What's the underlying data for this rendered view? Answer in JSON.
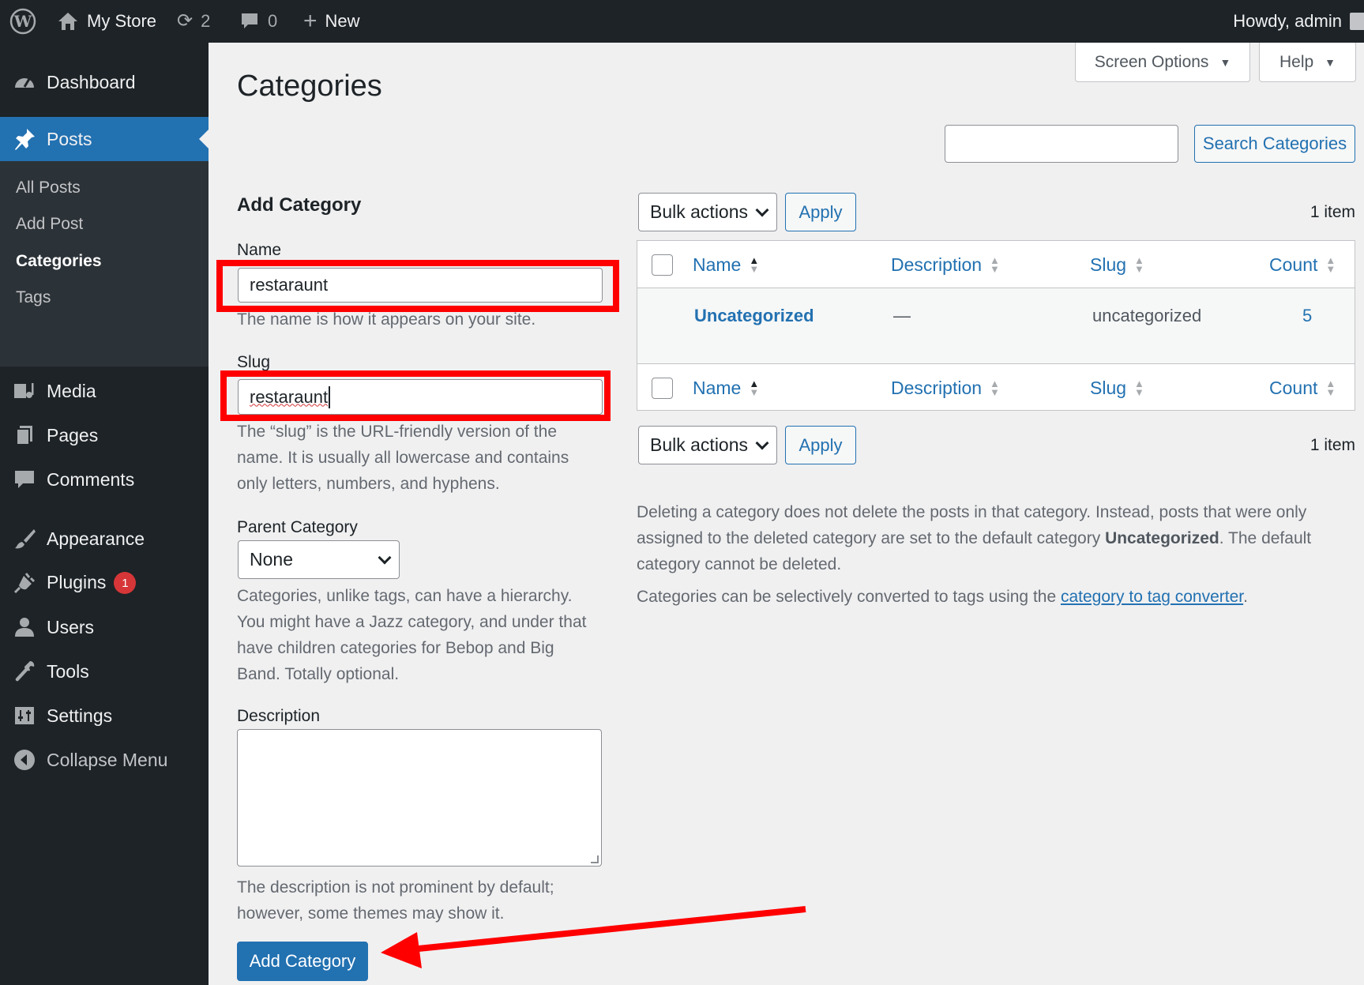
{
  "adminbar": {
    "site_name": "My Store",
    "updates_count": "2",
    "comments_count": "0",
    "new_label": "New",
    "greeting": "Howdy, admin"
  },
  "sidebar": {
    "dashboard": "Dashboard",
    "posts": "Posts",
    "submenu": {
      "all_posts": "All Posts",
      "add_post": "Add Post",
      "categories": "Categories",
      "tags": "Tags"
    },
    "media": "Media",
    "pages": "Pages",
    "comments": "Comments",
    "appearance": "Appearance",
    "plugins": "Plugins",
    "plugins_badge": "1",
    "users": "Users",
    "tools": "Tools",
    "settings": "Settings",
    "collapse": "Collapse Menu"
  },
  "header": {
    "title": "Categories",
    "screen_options": "Screen Options",
    "help": "Help"
  },
  "search": {
    "value": "",
    "button": "Search Categories"
  },
  "form": {
    "heading": "Add Category",
    "name_label": "Name",
    "name_value": "restaraunt",
    "name_hint": "The name is how it appears on your site.",
    "slug_label": "Slug",
    "slug_value": "restaraunt",
    "slug_hint": "The “slug” is the URL-friendly version of the name. It is usually all lowercase and contains only letters, numbers, and hyphens.",
    "parent_label": "Parent Category",
    "parent_value": "None",
    "parent_hint": "Categories, unlike tags, can have a hierarchy. You might have a Jazz category, and under that have children categories for Bebop and Big Band. Totally optional.",
    "description_label": "Description",
    "description_hint": "The description is not prominent by default; however, some themes may show it.",
    "submit": "Add Category"
  },
  "list": {
    "bulk_actions": "Bulk actions",
    "apply": "Apply",
    "item_count": "1 item",
    "columns": {
      "name": "Name",
      "description": "Description",
      "slug": "Slug",
      "count": "Count"
    },
    "rows": [
      {
        "name": "Uncategorized",
        "description": "—",
        "slug": "uncategorized",
        "count": "5"
      }
    ]
  },
  "notes": {
    "p1_before": "Deleting a category does not delete the posts in that category. Instead, posts that were only assigned to the deleted category are set to the default category ",
    "p1_bold": "Uncategorized",
    "p1_after": ". The default category cannot be deleted.",
    "p2_before": "Categories can be selectively converted to tags using the ",
    "p2_link": "category to tag converter",
    "p2_after": "."
  },
  "colors": {
    "admin_bar": "#1d2327",
    "accent": "#2271b1",
    "highlight": "#ff0000"
  }
}
